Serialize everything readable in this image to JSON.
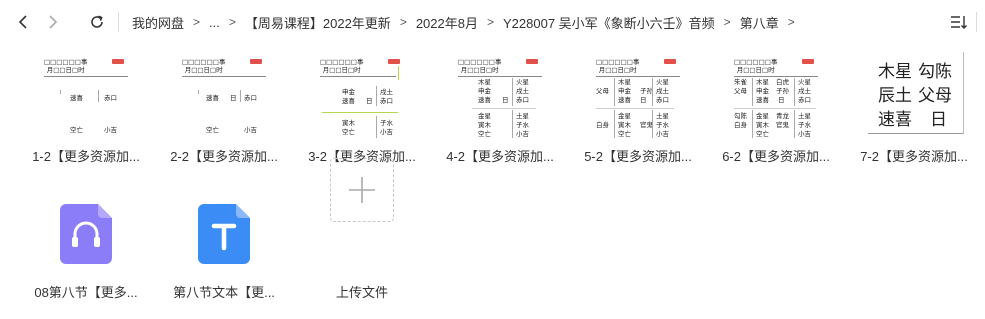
{
  "toolbar": {
    "back": "back-arrow",
    "forward": "forward-arrow",
    "refresh": "refresh"
  },
  "breadcrumb": [
    "我的网盘",
    "...",
    "【周易课程】2022年更新",
    "2022年8月",
    "Y228007 吴小军《象断小六壬》音频",
    "第八章"
  ],
  "breadcrumb_separator": ">",
  "files": [
    {
      "name": "1-2【更多资源加...",
      "type": "image"
    },
    {
      "name": "2-2【更多资源加...",
      "type": "image"
    },
    {
      "name": "3-2【更多资源加...",
      "type": "image"
    },
    {
      "name": "4-2【更多资源加...",
      "type": "image"
    },
    {
      "name": "5-2【更多资源加...",
      "type": "image"
    },
    {
      "name": "6-2【更多资源加...",
      "type": "image"
    },
    {
      "name": "7-2【更多资源加...",
      "type": "image"
    },
    {
      "name": "08第八节【更多...",
      "type": "audio"
    },
    {
      "name": "第八节文本【更...",
      "type": "text"
    },
    {
      "name": "上传文件",
      "type": "upload"
    }
  ],
  "thumb_text": {
    "header1": "□□□□□□事",
    "header2": "月□□日□时",
    "t1": {
      "r1": "速喜",
      "r2": "赤口",
      "r3": "空亡",
      "r4": "小吉"
    },
    "t2": {
      "r1": "速喜",
      "r1b": "日",
      "r2": "赤口",
      "r3": "空亡",
      "r4": "小吉"
    },
    "t3": {
      "a": "申金",
      "b": "速喜",
      "c": "日",
      "d": "戌土",
      "e": "赤口",
      "f": "寅木",
      "g": "空亡",
      "h": "子水",
      "i": "小吉"
    },
    "t4": {
      "a": "木星",
      "b": "申金",
      "c": "速喜",
      "d": "日",
      "e": "火星",
      "f": "戌土",
      "g": "赤口",
      "h": "金星",
      "i": "寅木",
      "j": "空亡",
      "k": "土星",
      "l": "子水",
      "m": "小吉"
    },
    "t5": {
      "a": "父母",
      "b": "木星",
      "c": "申金",
      "d": "速喜",
      "e": "子孙",
      "f": "日",
      "g": "火星",
      "h": "戌土",
      "i": "赤口",
      "j": "白身",
      "k": "金星",
      "l": "寅木",
      "m": "官鬼",
      "n": "空亡",
      "o": "土星",
      "p": "子水",
      "q": "小吉"
    },
    "t6": {
      "a": "朱雀",
      "b": "父母",
      "c": "木星",
      "d": "申金",
      "e": "速喜",
      "f": "白虎",
      "g": "子孙",
      "h": "日",
      "i": "火星",
      "j": "戌土",
      "k": "赤口",
      "l": "勾陈",
      "m": "白身",
      "n": "金星",
      "o": "寅木",
      "p": "空亡",
      "q": "青龙",
      "r": "官鬼",
      "s": "土星",
      "t": "子水",
      "u": "小吉"
    },
    "t7": {
      "r1a": "木星",
      "r1b": "勾陈",
      "r2a": "辰土",
      "r2b": "父母",
      "r3a": "速喜",
      "r3b": "日"
    }
  },
  "colors": {
    "accent_blue": "#3b8cf5",
    "audio_purple": "#8b7cf7",
    "stamp_red": "#e2504a"
  }
}
